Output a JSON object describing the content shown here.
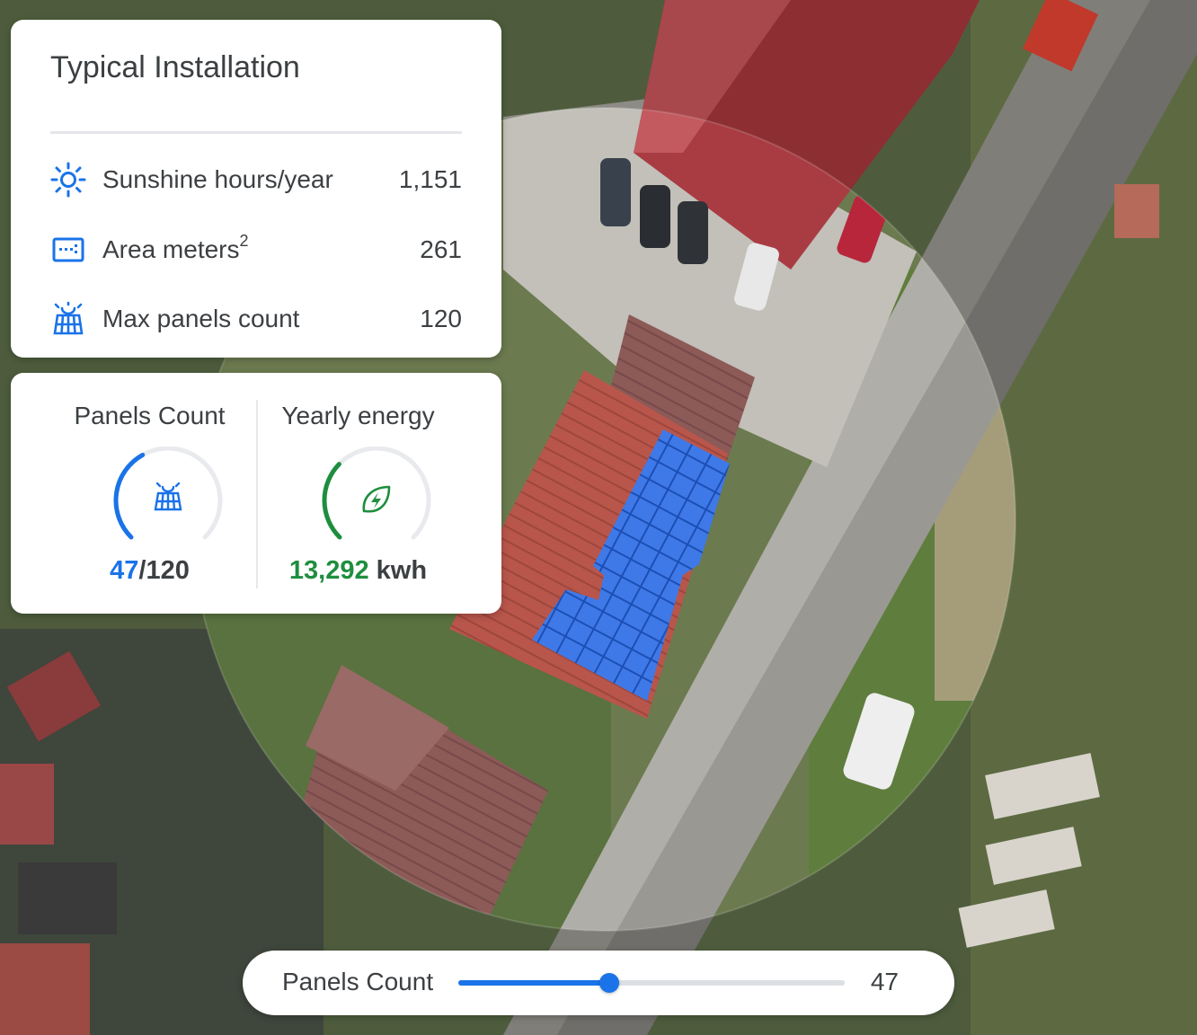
{
  "info": {
    "title": "Typical Installation",
    "rows": [
      {
        "icon": "sun-icon",
        "label": "Sunshine hours/year",
        "value": "1,151"
      },
      {
        "icon": "area-icon",
        "label": "Area meters",
        "label_sup": "2",
        "value": "261"
      },
      {
        "icon": "solar-panel-icon",
        "label": "Max panels count",
        "value": "120"
      }
    ]
  },
  "stats": {
    "panels": {
      "title": "Panels Count",
      "current": "47",
      "suffix": "/120",
      "fraction": 0.3917,
      "color": "#1a73e8",
      "icon": "solar-panel-icon"
    },
    "energy": {
      "title": "Yearly energy",
      "current": "13,292",
      "suffix": " kwh",
      "fraction": 0.33,
      "color": "#1e8e3e",
      "icon": "eco-bolt-icon"
    }
  },
  "slider": {
    "label": "Panels Count",
    "value": "47",
    "fraction": 0.3917
  },
  "colors": {
    "accent_blue": "#1a73e8",
    "accent_green": "#1e8e3e",
    "panel_blue": "#2f6fe0"
  }
}
